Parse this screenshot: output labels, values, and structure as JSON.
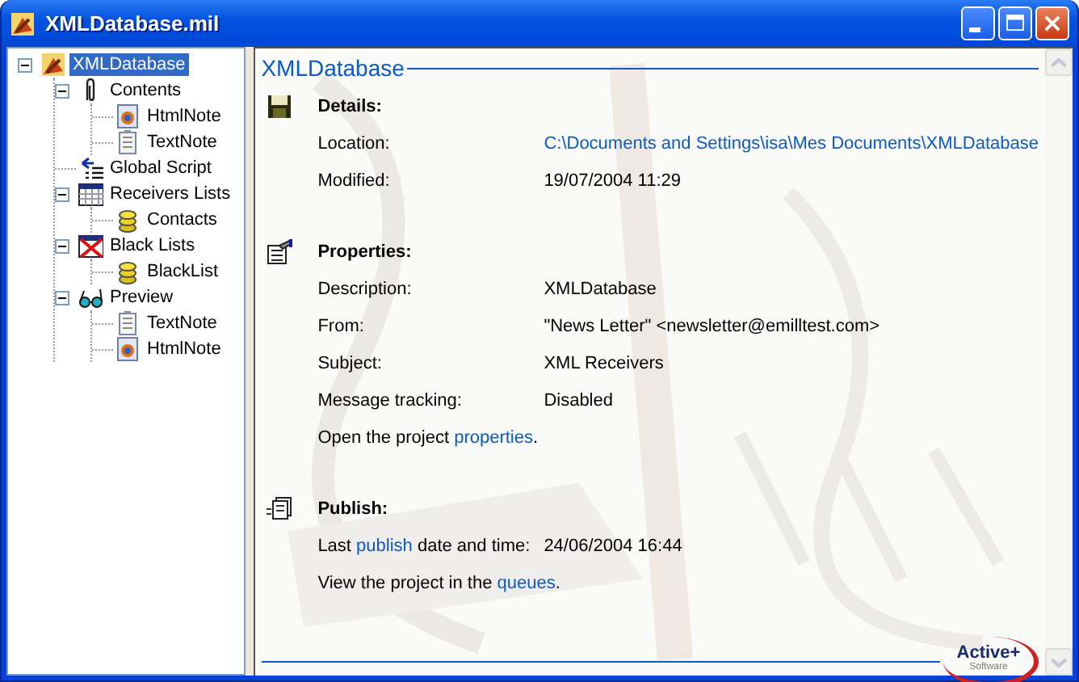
{
  "window": {
    "title": "XMLDatabase.mil"
  },
  "tree": [
    {
      "label": "XMLDatabase",
      "kind": "project",
      "expanded": true,
      "selected": true,
      "children": [
        {
          "label": "Contents",
          "kind": "attachments",
          "expanded": true,
          "selected": false,
          "children": [
            {
              "label": "HtmlNote",
              "kind": "htmlnote",
              "selected": false
            },
            {
              "label": "TextNote",
              "kind": "textnote",
              "selected": false
            }
          ]
        },
        {
          "label": "Global Script",
          "kind": "script",
          "selected": false
        },
        {
          "label": "Receivers Lists",
          "kind": "lists",
          "expanded": true,
          "selected": false,
          "children": [
            {
              "label": "Contacts",
              "kind": "list",
              "selected": false
            }
          ]
        },
        {
          "label": "Black Lists",
          "kind": "blocked",
          "expanded": true,
          "selected": false,
          "children": [
            {
              "label": "BlackList",
              "kind": "list",
              "selected": false
            }
          ]
        },
        {
          "label": "Preview",
          "kind": "preview",
          "expanded": true,
          "selected": false,
          "children": [
            {
              "label": "TextNote",
              "kind": "textnote",
              "selected": false
            },
            {
              "label": "HtmlNote",
              "kind": "htmlnote",
              "selected": false
            }
          ]
        }
      ]
    }
  ],
  "panel": {
    "title": "XMLDatabase",
    "sections": [
      {
        "title": "Details:",
        "rows": [
          {
            "kind": "link-field",
            "label": "Location:",
            "value": "C:\\Documents and Settings\\isa\\Mes Documents\\XMLDatabase"
          },
          {
            "kind": "field",
            "label": "Modified:",
            "value": "19/07/2004 11:29"
          }
        ]
      },
      {
        "title": "Properties:",
        "rows": [
          {
            "kind": "field",
            "label": "Description:",
            "value": "XMLDatabase"
          },
          {
            "kind": "field",
            "label": "From:",
            "value": "\"News Letter\" <newsletter@emilltest.com>"
          },
          {
            "kind": "field",
            "label": "Subject:",
            "value": "XML Receivers"
          },
          {
            "kind": "field",
            "label": "Message tracking:",
            "value": "Disabled"
          },
          {
            "kind": "sentence",
            "text": "Open the project ",
            "link": "properties",
            "tail": "."
          }
        ]
      },
      {
        "title": "Publish:",
        "rows": [
          {
            "kind": "linked-label-field",
            "label": "Last ",
            "label_link": "publish",
            "label_tail": " date and time:",
            "value": "24/06/2004 16:44"
          },
          {
            "kind": "sentence",
            "text": "View the project in the ",
            "link": "queues",
            "tail": "."
          }
        ]
      }
    ],
    "logo": {
      "name": "Active+",
      "tagline": "Software"
    }
  }
}
